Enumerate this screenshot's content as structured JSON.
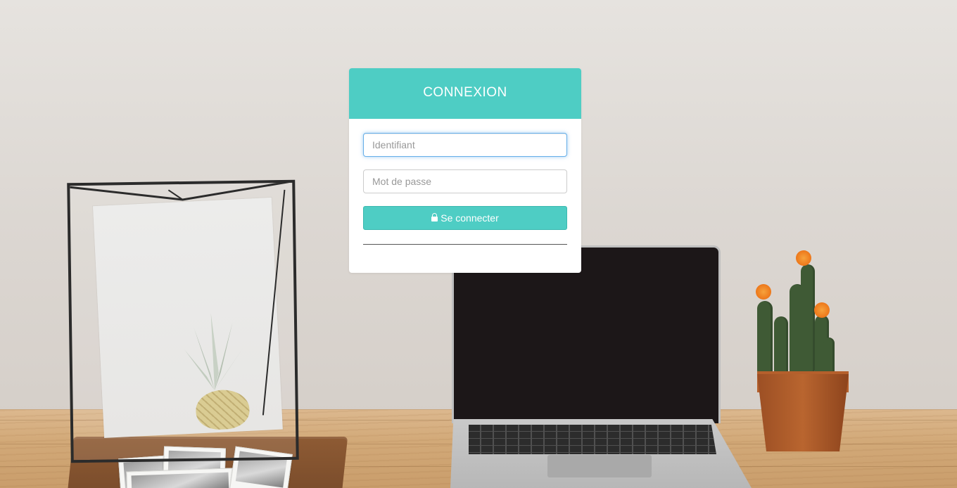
{
  "login": {
    "title": "CONNEXION",
    "username_placeholder": "Identifiant",
    "password_placeholder": "Mot de passe",
    "submit_label": "Se connecter",
    "submit_icon": "lock-icon"
  },
  "colors": {
    "accent": "#4ecdc4",
    "focus_ring": "#66afe9"
  }
}
